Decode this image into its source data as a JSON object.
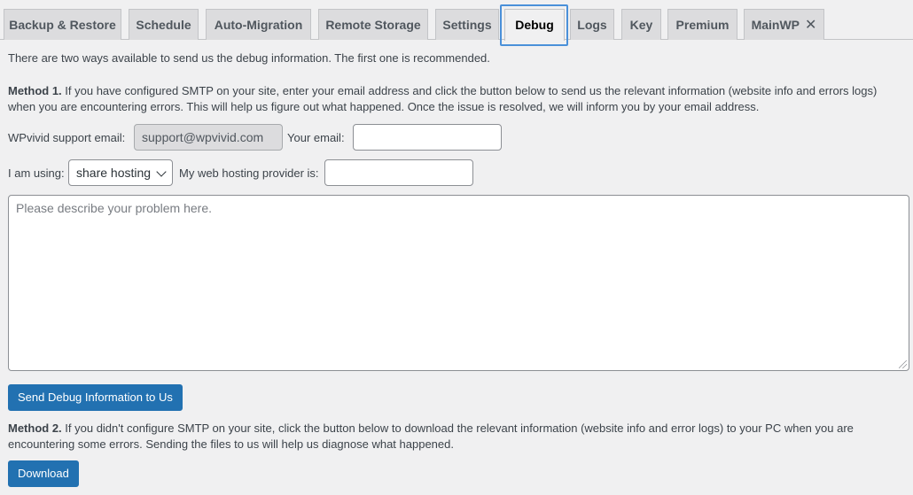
{
  "tabs": [
    {
      "label": "Backup & Restore"
    },
    {
      "label": "Schedule"
    },
    {
      "label": "Auto-Migration"
    },
    {
      "label": "Remote Storage"
    },
    {
      "label": "Settings"
    },
    {
      "label": "Debug",
      "active": true
    },
    {
      "label": "Logs"
    },
    {
      "label": "Key"
    },
    {
      "label": "Premium"
    },
    {
      "label": "MainWP",
      "closable": true
    }
  ],
  "intro": "There are two ways available to send us the debug information. The first one is recommended.",
  "method1": {
    "title": "Method 1.",
    "text": " If you have configured SMTP on your site, enter your email address and click the button below to send us the relevant information (website info and errors logs) when you are encountering errors. This will help us figure out what happened. Once the issue is resolved, we will inform you by your email address."
  },
  "form": {
    "support_email_label": "WPvivid support email:",
    "support_email_value": "support@wpvivid.com",
    "your_email_label": "Your email:",
    "your_email_value": "",
    "using_label": "I am using:",
    "using_value": "share hosting",
    "provider_label": "My web hosting provider is:",
    "provider_value": "",
    "description_placeholder": "Please describe your problem here."
  },
  "send_button": "Send Debug Information to Us",
  "method2": {
    "title": "Method 2.",
    "text": " If you didn't configure SMTP on your site, click the button below to download the relevant information (website info and error logs) to your PC when you are encountering some errors. Sending the files to us will help us diagnose what happened."
  },
  "download_button": "Download"
}
